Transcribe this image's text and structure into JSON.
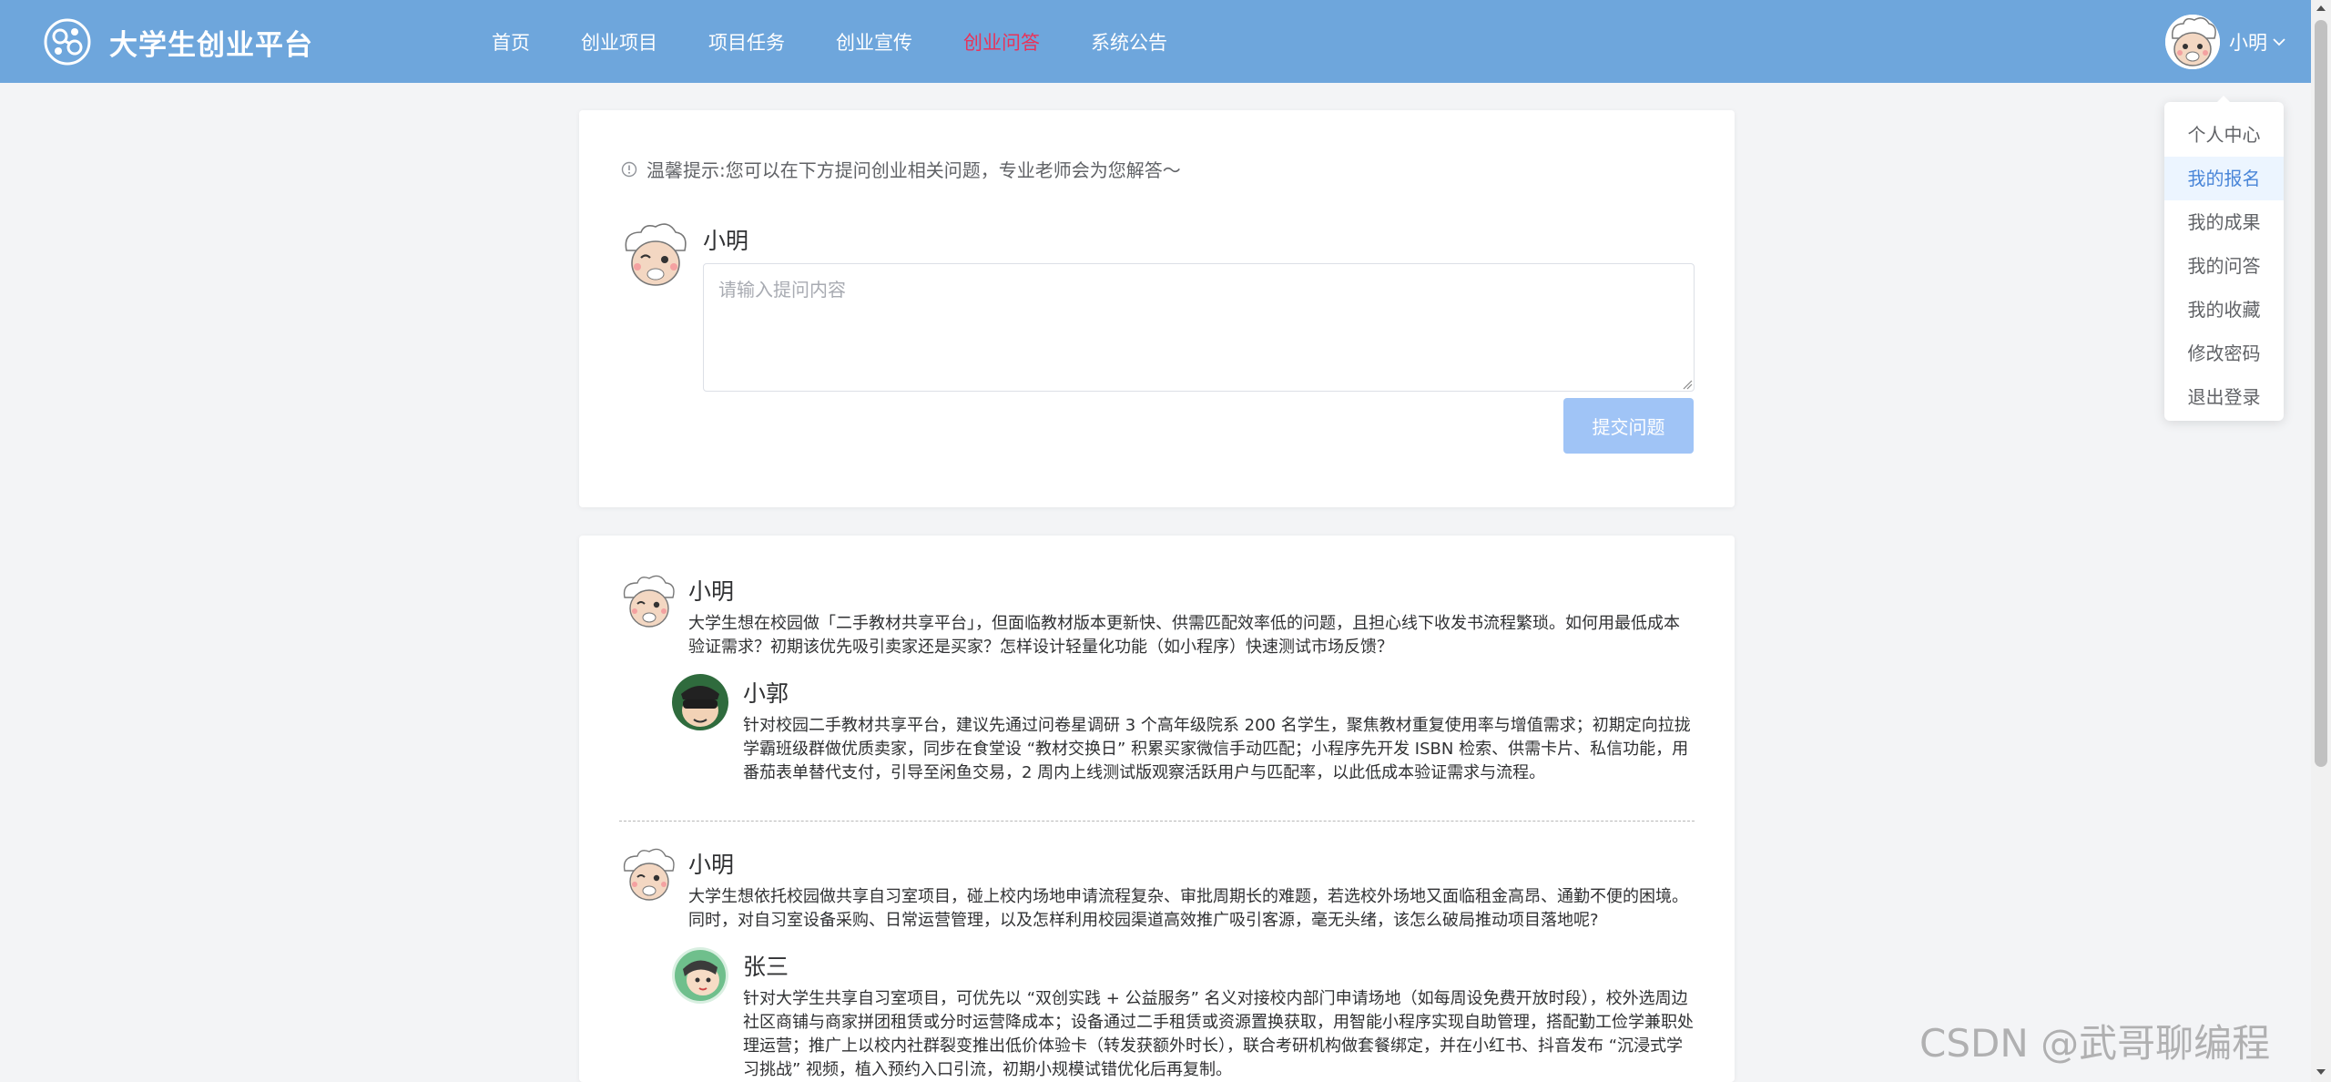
{
  "header": {
    "brand_name": "大学生创业平台",
    "nav": [
      {
        "label": "首页",
        "active": false
      },
      {
        "label": "创业项目",
        "active": false
      },
      {
        "label": "项目任务",
        "active": false
      },
      {
        "label": "创业宣传",
        "active": false
      },
      {
        "label": "创业问答",
        "active": true
      },
      {
        "label": "系统公告",
        "active": false
      }
    ],
    "user_name": "小明",
    "colors": {
      "bar": "#6ea6dc",
      "active_nav": "#e8335a"
    }
  },
  "dropdown": {
    "items": [
      "个人中心",
      "我的报名",
      "我的成果",
      "我的问答",
      "我的收藏",
      "修改密码",
      "退出登录"
    ],
    "highlighted": "我的报名"
  },
  "ask": {
    "tip": "温馨提示:您可以在下方提问创业相关问题，专业老师会为您解答～",
    "user_name": "小明",
    "placeholder": "请输入提问内容",
    "value": "",
    "submit_label": "提交问题"
  },
  "qa_list": [
    {
      "question_user": "小明",
      "question": "大学生想在校园做「二手教材共享平台」，但面临教材版本更新快、供需匹配效率低的问题，且担心线下收发书流程繁琐。如何用最低成本验证需求？初期该优先吸引卖家还是买家？怎样设计轻量化功能（如小程序）快速测试市场反馈？",
      "answer_user": "小郭",
      "answer": "针对校园二手教材共享平台，建议先通过问卷星调研 3 个高年级院系 200 名学生，聚焦教材重复使用率与增值需求；初期定向拉拢学霸班级群做优质卖家，同步在食堂设 “教材交换日” 积累买家微信手动匹配；小程序先开发 ISBN 检索、供需卡片、私信功能，用番茄表单替代支付，引导至闲鱼交易，2 周内上线测试版观察活跃用户与匹配率，以此低成本验证需求与流程。"
    },
    {
      "question_user": "小明",
      "question": "大学生想依托校园做共享自习室项目，碰上校内场地申请流程复杂、审批周期长的难题，若选校外场地又面临租金高昂、通勤不便的困境。同时，对自习室设备采购、日常运营管理，以及怎样利用校园渠道高效推广吸引客源，毫无头绪，该怎么破局推动项目落地呢?",
      "answer_user": "张三",
      "answer": "针对大学生共享自习室项目，可优先以 “双创实践 + 公益服务” 名义对接校内部门申请场地（如每周设免费开放时段），校外选周边社区商铺与商家拼团租赁或分时运营降成本；设备通过二手租赁或资源置换获取，用智能小程序实现自助管理，搭配勤工俭学兼职处理运营；推广上以校内社群裂变推出低价体验卡（转发获额外时长），联合考研机构做套餐绑定，并在小红书、抖音发布 “沉浸式学习挑战” 视频，植入预约入口引流，初期小规模试错优化后再复制。"
    }
  ],
  "watermark": "CSDN @武哥聊编程"
}
